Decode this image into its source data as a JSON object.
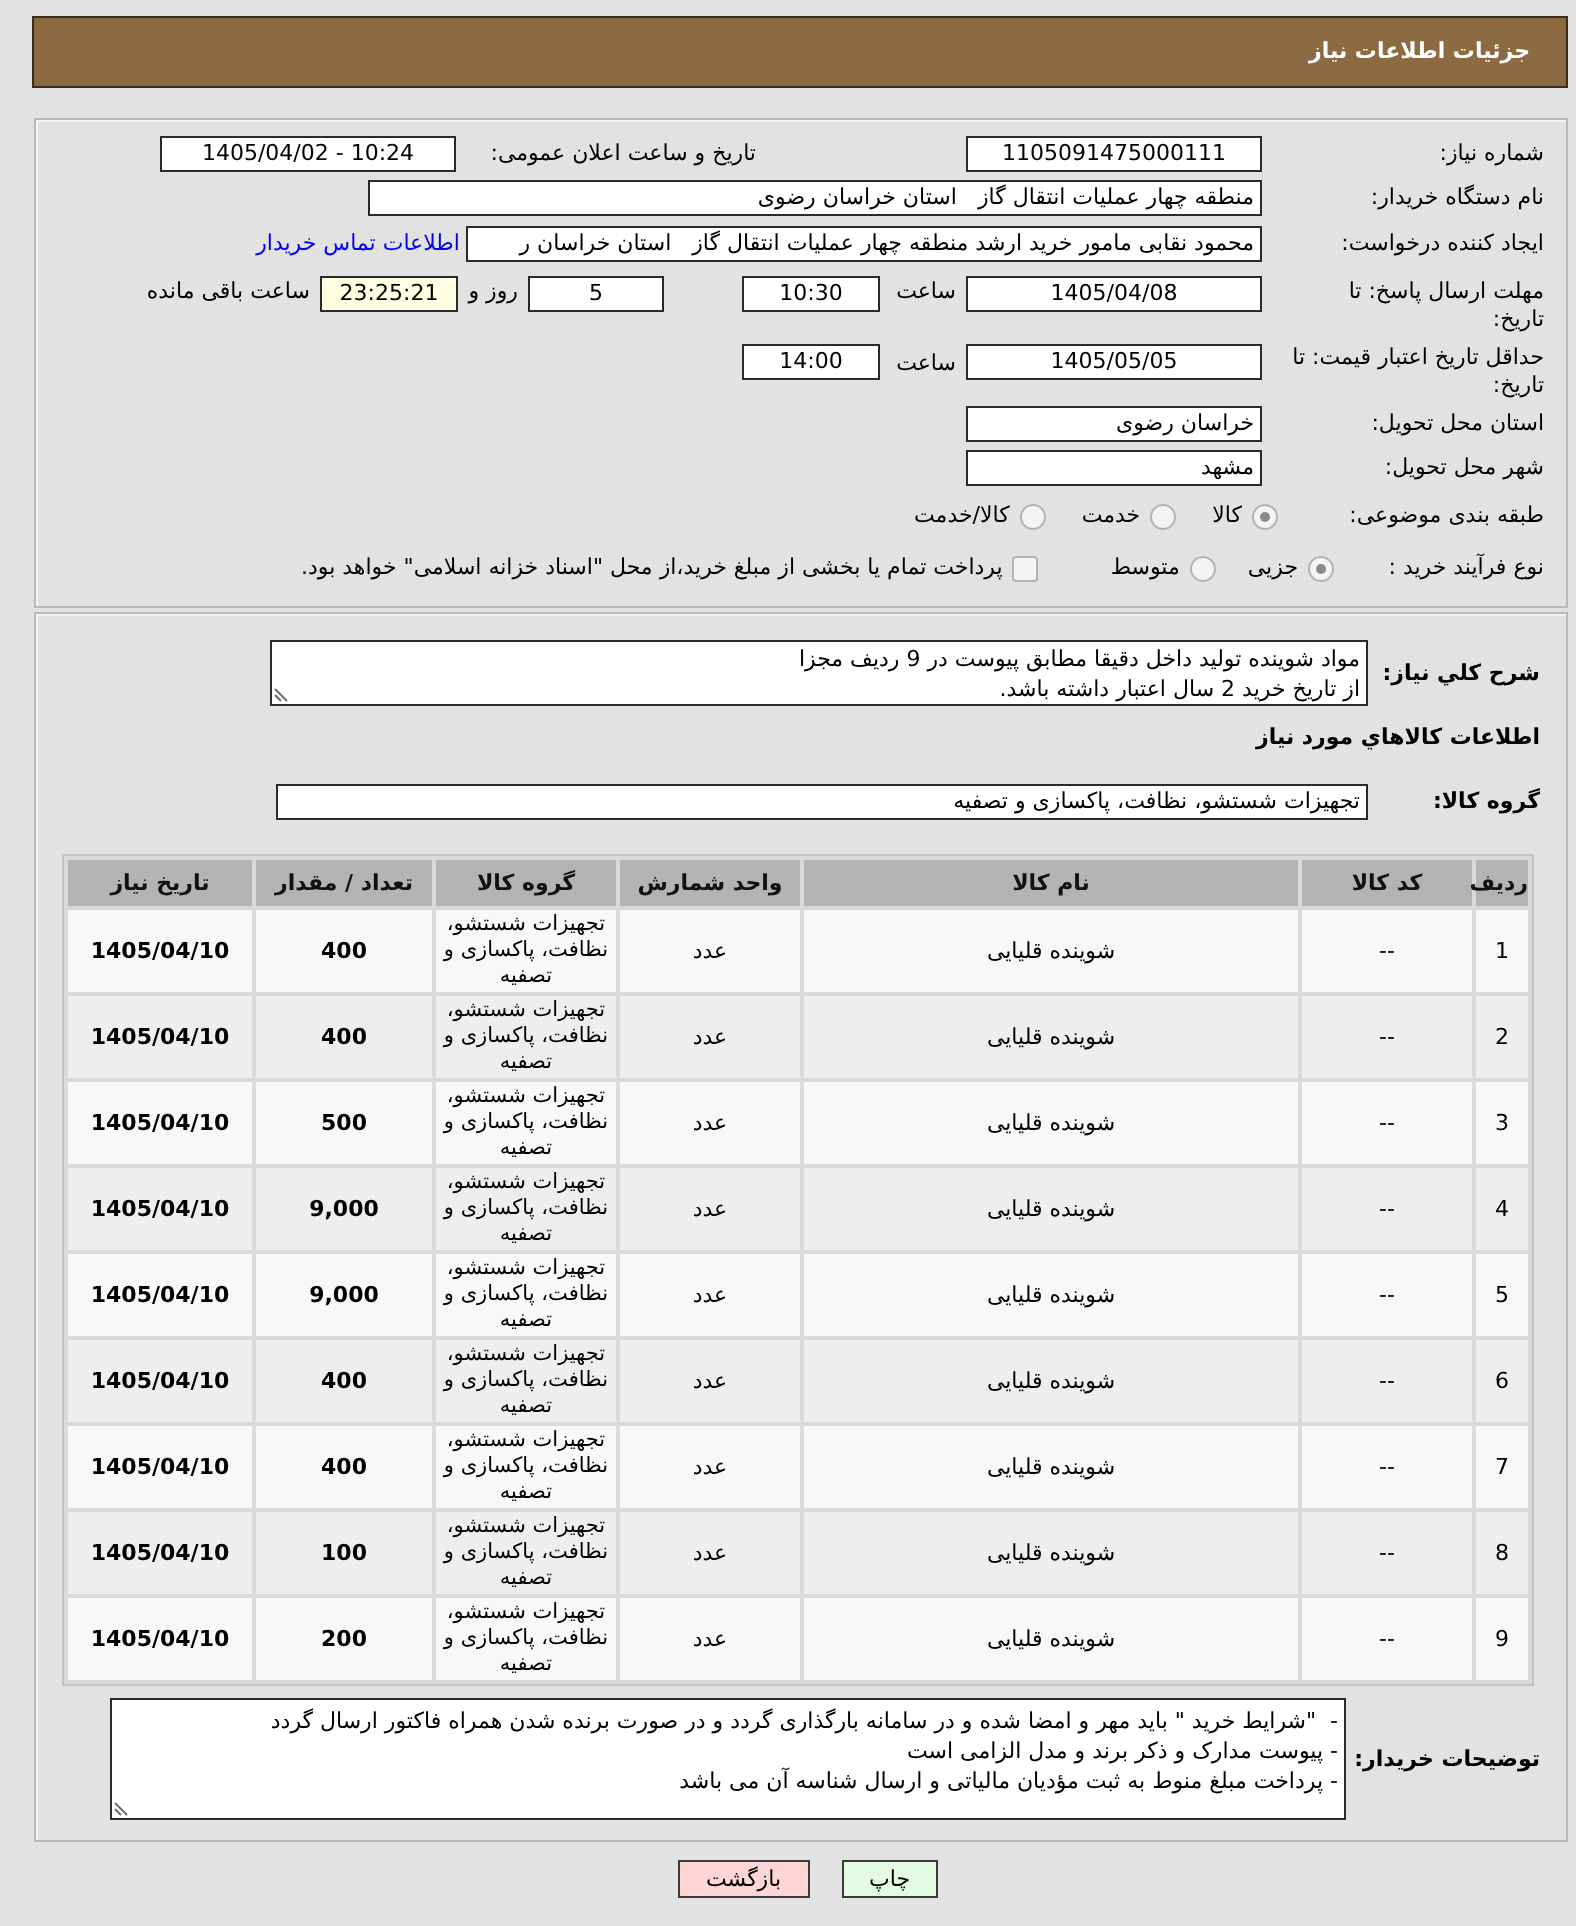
{
  "header": {
    "title": "جزئیات اطلاعات نیاز"
  },
  "details": {
    "need_number": {
      "label": "شماره نیاز:",
      "value": "1105091475000111"
    },
    "announcement": {
      "label": "تاریخ و ساعت اعلان عمومی:",
      "value": "1405/04/02 - 10:24"
    },
    "buyer_organization": {
      "label": "نام دستگاه خریدار:",
      "value": "منطقه چهار عملیات انتقال گاز   استان خراسان رضوی"
    },
    "requester": {
      "label": "ایجاد کننده درخواست:",
      "value": "محمود نقابی مامور خرید ارشد منطقه چهار عملیات انتقال گاز   استان خراسان ر",
      "link": "اطلاعات تماس خریدار"
    },
    "reply_deadline": {
      "label": "مهلت ارسال پاسخ: تا تاریخ:",
      "date": "1405/04/08",
      "time_label": "ساعت",
      "time": "10:30",
      "days": "5",
      "days_label": "روز و",
      "remaining": "23:25:21",
      "remaining_label": "ساعت باقی مانده"
    },
    "price_validity": {
      "label": "حداقل تاریخ اعتبار قیمت: تا تاریخ:",
      "date": "1405/05/05",
      "time_label": "ساعت",
      "time": "14:00"
    },
    "delivery_province": {
      "label": "استان محل تحویل:",
      "value": "خراسان رضوی"
    },
    "delivery_city": {
      "label": "شهر محل تحویل:",
      "value": "مشهد"
    },
    "category": {
      "label": "طبقه بندی موضوعی:",
      "options": [
        {
          "label": "کالا",
          "selected": true
        },
        {
          "label": "خدمت",
          "selected": false
        },
        {
          "label": "کالا/خدمت",
          "selected": false
        }
      ]
    },
    "purchase_process": {
      "label": "نوع فرآیند خرید :",
      "options": [
        {
          "label": "جزیی",
          "selected": true
        },
        {
          "label": "متوسط",
          "selected": false
        }
      ],
      "treasury_payment": {
        "label": "پرداخت تمام یا بخشی از مبلغ خرید،از محل \"اسناد خزانه اسلامی\" خواهد بود.",
        "checked": false
      }
    }
  },
  "description": {
    "label": "شرح کلي نیاز:",
    "text": "مواد شوینده تولید داخل دقیقا مطابق پیوست در 9 ردیف مجزا\nاز تاریخ خرید 2 سال اعتبار داشته باشد."
  },
  "goods": {
    "title": "اطلاعات کالاهاي مورد نیاز",
    "group_label": "گروه کالا:",
    "group_value": "تجهیزات شستشو، نظافت، پاکسازی و تصفیه"
  },
  "table": {
    "columns": [
      "ردیف",
      "کد کالا",
      "نام کالا",
      "واحد شمارش",
      "گروه کالا",
      "تعداد / مقدار",
      "تاریخ نیاز"
    ],
    "rows": [
      {
        "row_number": "1",
        "code": "--",
        "name": "شوینده قلیایی",
        "unit": "عدد",
        "group": "تجهیزات شستشو، نظافت، پاکسازی و تصفیه",
        "quantity": "400",
        "date": "1405/04/10"
      },
      {
        "row_number": "2",
        "code": "--",
        "name": "شوینده قلیایی",
        "unit": "عدد",
        "group": "تجهیزات شستشو، نظافت، پاکسازی و تصفیه",
        "quantity": "400",
        "date": "1405/04/10"
      },
      {
        "row_number": "3",
        "code": "--",
        "name": "شوینده قلیایی",
        "unit": "عدد",
        "group": "تجهیزات شستشو، نظافت، پاکسازی و تصفیه",
        "quantity": "500",
        "date": "1405/04/10"
      },
      {
        "row_number": "4",
        "code": "--",
        "name": "شوینده قلیایی",
        "unit": "عدد",
        "group": "تجهیزات شستشو، نظافت، پاکسازی و تصفیه",
        "quantity": "9,000",
        "date": "1405/04/10"
      },
      {
        "row_number": "5",
        "code": "--",
        "name": "شوینده قلیایی",
        "unit": "عدد",
        "group": "تجهیزات شستشو، نظافت، پاکسازی و تصفیه",
        "quantity": "9,000",
        "date": "1405/04/10"
      },
      {
        "row_number": "6",
        "code": "--",
        "name": "شوینده قلیایی",
        "unit": "عدد",
        "group": "تجهیزات شستشو، نظافت، پاکسازی و تصفیه",
        "quantity": "400",
        "date": "1405/04/10"
      },
      {
        "row_number": "7",
        "code": "--",
        "name": "شوینده قلیایی",
        "unit": "عدد",
        "group": "تجهیزات شستشو، نظافت، پاکسازی و تصفیه",
        "quantity": "400",
        "date": "1405/04/10"
      },
      {
        "row_number": "8",
        "code": "--",
        "name": "شوینده قلیایی",
        "unit": "عدد",
        "group": "تجهیزات شستشو، نظافت، پاکسازی و تصفیه",
        "quantity": "100",
        "date": "1405/04/10"
      },
      {
        "row_number": "9",
        "code": "--",
        "name": "شوینده قلیایی",
        "unit": "عدد",
        "group": "تجهیزات شستشو، نظافت، پاکسازی و تصفیه",
        "quantity": "200",
        "date": "1405/04/10"
      }
    ]
  },
  "buyer_notes": {
    "label": "توضیحات خریدار:",
    "text": "-  \"شرایط خرید \" باید مهر و امضا شده و در سامانه بارگذاری گردد و در صورت برنده شدن همراه فاکتور ارسال گردد\n- پیوست مدارک و ذکر برند و مدل الزامی است\n- پرداخت مبلغ منوط به ثبت مؤدیان مالیاتی و ارسال شناسه آن می باشد"
  },
  "buttons": [
    {
      "label": "چاپ",
      "kind": "print"
    },
    {
      "label": "بازگشت",
      "kind": "back"
    }
  ]
}
